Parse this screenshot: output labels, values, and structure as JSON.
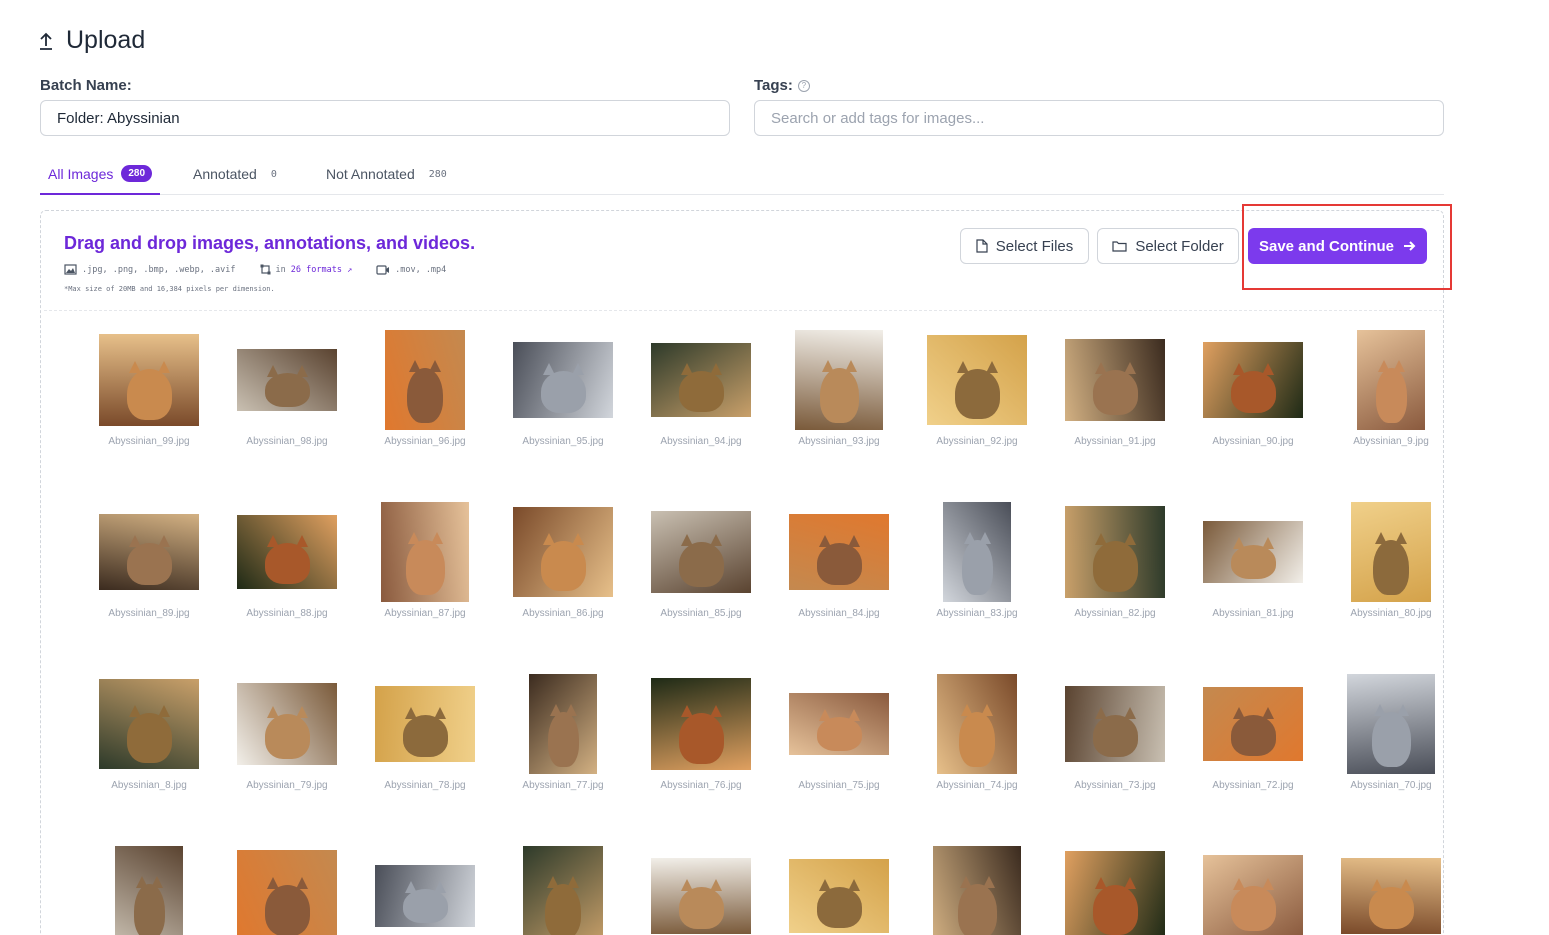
{
  "page": {
    "title": "Upload",
    "icon": "upload-icon"
  },
  "form": {
    "batch_label": "Batch Name:",
    "batch_value": "Folder: Abyssinian",
    "tags_label": "Tags:",
    "tags_placeholder": "Search or add tags for images..."
  },
  "tabs": [
    {
      "label": "All Images",
      "count": "280",
      "active": true
    },
    {
      "label": "Annotated",
      "count": "0",
      "active": false
    },
    {
      "label": "Not Annotated",
      "count": "280",
      "active": false
    }
  ],
  "dropzone": {
    "title": "Drag and drop images, annotations, and videos.",
    "image_formats": ".jpg, .png, .bmp, .webp, .avif",
    "annotation_prefix": "in",
    "annotation_count": "26",
    "annotation_suffix": "formats",
    "video_formats": ".mov, .mp4",
    "max_note": "*Max size of 20MB and 16,384 pixels per dimension."
  },
  "actions": {
    "select_files": "Select Files",
    "select_folder": "Select Folder",
    "save_continue": "Save and Continue",
    "accent": "#7c3aed",
    "highlight": "#e53935"
  },
  "images": [
    "Abyssinian_99.jpg",
    "Abyssinian_98.jpg",
    "Abyssinian_96.jpg",
    "Abyssinian_95.jpg",
    "Abyssinian_94.jpg",
    "Abyssinian_93.jpg",
    "Abyssinian_92.jpg",
    "Abyssinian_91.jpg",
    "Abyssinian_90.jpg",
    "Abyssinian_9.jpg",
    "Abyssinian_89.jpg",
    "Abyssinian_88.jpg",
    "Abyssinian_87.jpg",
    "Abyssinian_86.jpg",
    "Abyssinian_85.jpg",
    "Abyssinian_84.jpg",
    "Abyssinian_83.jpg",
    "Abyssinian_82.jpg",
    "Abyssinian_81.jpg",
    "Abyssinian_80.jpg",
    "Abyssinian_8.jpg",
    "Abyssinian_79.jpg",
    "Abyssinian_78.jpg",
    "Abyssinian_77.jpg",
    "Abyssinian_76.jpg",
    "Abyssinian_75.jpg",
    "Abyssinian_74.jpg",
    "Abyssinian_73.jpg",
    "Abyssinian_72.jpg",
    "Abyssinian_70.jpg",
    "",
    "",
    "",
    "",
    "",
    "",
    "",
    "",
    "",
    ""
  ]
}
